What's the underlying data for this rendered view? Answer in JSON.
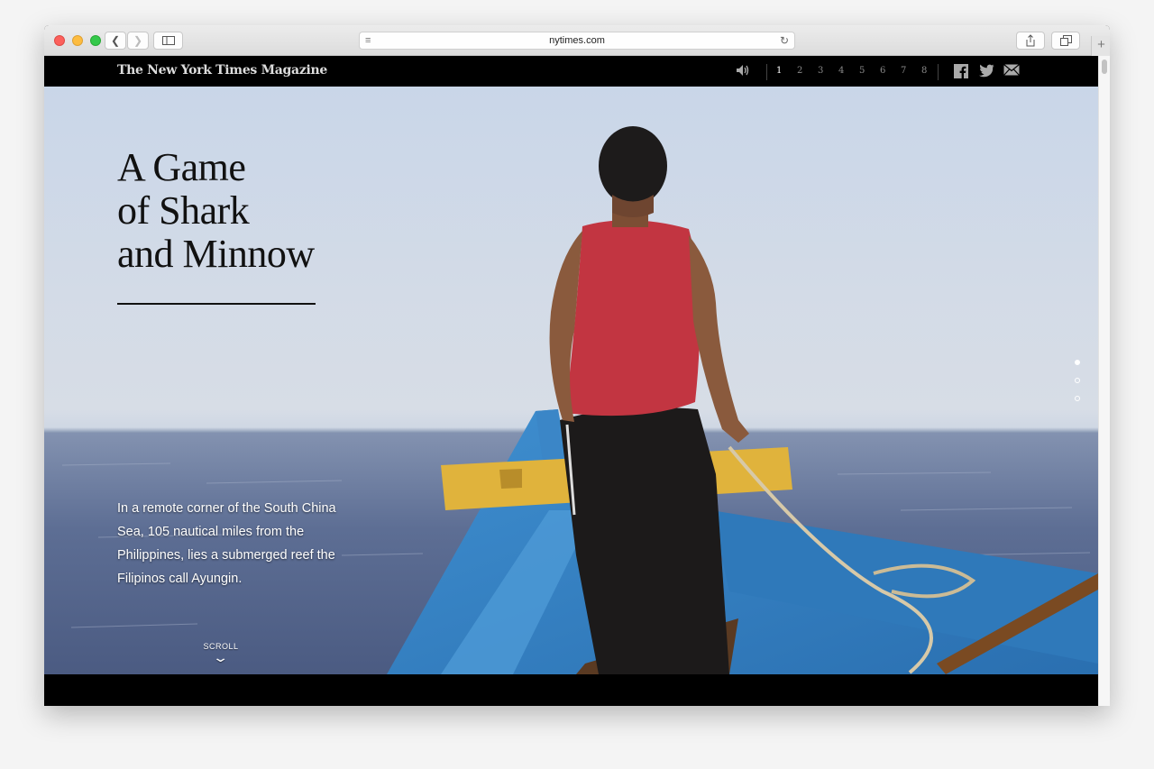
{
  "browser": {
    "url": "nytimes.com",
    "icons": {
      "back": "chevron-left-icon",
      "forward": "chevron-right-icon",
      "sidebar": "sidebar-icon",
      "reader": "reader-icon",
      "reload": "reload-icon",
      "share": "share-icon",
      "tabs": "tabs-icon",
      "new_tab": "plus-icon"
    }
  },
  "header": {
    "logo": "The New York Times Magazine",
    "pages": [
      "1",
      "2",
      "3",
      "4",
      "5",
      "6",
      "7",
      "8"
    ],
    "active_page": "1",
    "social": [
      "facebook-icon",
      "twitter-icon",
      "email-icon"
    ]
  },
  "article": {
    "headline_lines": [
      "A Game",
      "of Shark",
      "and Minnow"
    ],
    "dek": "In a remote corner of the South China Sea, 105 nautical miles from the Philippines, lies a submerged reef the Filipinos call Ayungin.",
    "scroll_label": "SCROLL",
    "section_dots": [
      true,
      false,
      false
    ]
  }
}
